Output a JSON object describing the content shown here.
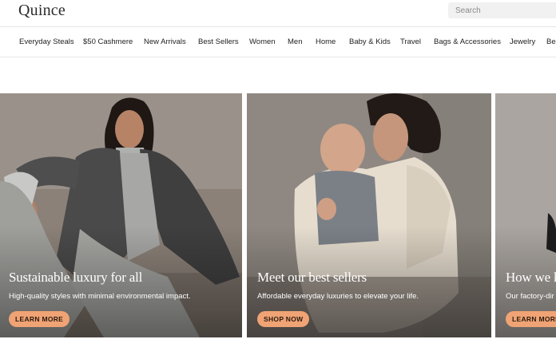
{
  "header": {
    "logo": "Quince",
    "search": {
      "placeholder": "Search",
      "value": ""
    }
  },
  "nav": {
    "items": [
      {
        "label": "Everyday Steals"
      },
      {
        "label": "$50 Cashmere"
      },
      {
        "label": "New Arrivals"
      },
      {
        "label": "Best Sellers"
      },
      {
        "label": "Women"
      },
      {
        "label": "Men"
      },
      {
        "label": "Home"
      },
      {
        "label": "Baby & Kids"
      },
      {
        "label": "Travel"
      },
      {
        "label": "Bags & Accessories"
      },
      {
        "label": "Jewelry"
      },
      {
        "label": "Bea"
      }
    ]
  },
  "hero": {
    "cards": [
      {
        "title": "Sustainable luxury for all",
        "subtitle": "High-quality styles with minimal environmental impact.",
        "button": "LEARN MORE"
      },
      {
        "title": "Meet our best sellers",
        "subtitle": "Affordable everyday luxuries to elevate your life.",
        "button": "SHOP NOW"
      },
      {
        "title": "How we ke",
        "subtitle": "Our factory-dir",
        "button": "LEARN MORE"
      }
    ]
  },
  "colors": {
    "button_bg": "#f0a374",
    "nav_border": "#e6e6e6",
    "search_bg": "#f1f1f1"
  }
}
